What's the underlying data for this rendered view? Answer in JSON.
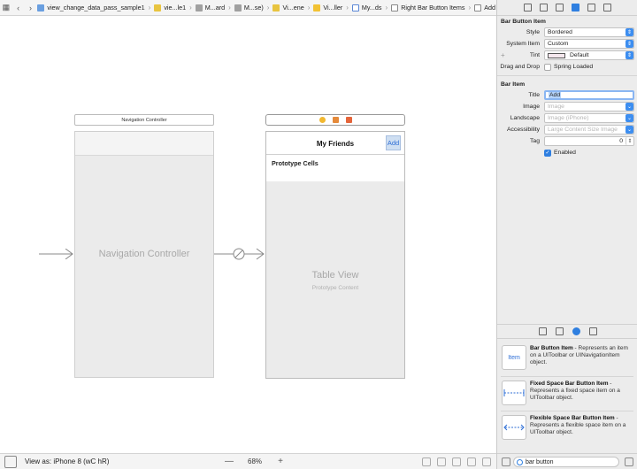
{
  "jumpbar": {
    "crumbs": [
      {
        "label": "view_change_data_pass_sample1",
        "icon": "file-icon"
      },
      {
        "label": "vie...le1",
        "icon": "folder-icon"
      },
      {
        "label": "M...ard",
        "icon": "storyboard-icon"
      },
      {
        "label": "M...se)",
        "icon": "storyboard-icon"
      },
      {
        "label": "Vi...ene",
        "icon": "folder-icon"
      },
      {
        "label": "Vi...ller",
        "icon": "scene-icon"
      },
      {
        "label": "My...ds",
        "icon": "navigation-item-icon"
      },
      {
        "label": "Right Bar Button Items",
        "icon": "item-icon"
      },
      {
        "label": "Add",
        "icon": "bar-button-icon"
      }
    ]
  },
  "canvas": {
    "nav_controller_title": "Navigation Controller",
    "nav_controller_label": "Navigation Controller",
    "table_title": "My Friends",
    "add_button": "Add",
    "prototype_cells": "Prototype Cells",
    "table_view_label": "Table View",
    "prototype_content": "Prototype Content"
  },
  "bottombar": {
    "view_as": "View as: iPhone 8 (",
    "view_as_size": "wC hR)",
    "zoom_out": "—",
    "zoom_value": "68%",
    "zoom_in": "+"
  },
  "inspector": {
    "bar_button_item": {
      "header": "Bar Button Item",
      "style_label": "Style",
      "style_value": "Bordered",
      "system_item_label": "System Item",
      "system_item_value": "Custom",
      "tint_label": "Tint",
      "tint_value": "Default",
      "drag_drop_label": "Drag and Drop",
      "spring_loaded": "Spring Loaded"
    },
    "bar_item": {
      "header": "Bar Item",
      "title_label": "Title",
      "title_value": "Add",
      "image_label": "Image",
      "image_placeholder": "Image",
      "landscape_label": "Landscape",
      "landscape_placeholder": "Image (iPhone)",
      "accessibility_label": "Accessibility",
      "accessibility_placeholder": "Large Content Size Image",
      "tag_label": "Tag",
      "tag_value": "0",
      "enabled_label": "Enabled"
    }
  },
  "library": {
    "items": [
      {
        "title": "Bar Button Item",
        "desc": " - Represents an item on a UIToolbar or UINavigationItem object.",
        "icon_text": "Item"
      },
      {
        "title": "Fixed Space Bar Button Item",
        "desc": " - Represents a fixed space item on a UIToolbar object."
      },
      {
        "title": "Flexible Space Bar Button Item",
        "desc": " - Represents a flexible space item on a UIToolbar object."
      }
    ],
    "search_value": "bar button"
  },
  "colors": {
    "accent": "#2f7fe0",
    "canvas_scene_bg": "#ebebeb",
    "add_highlight": "#cfdff2"
  }
}
